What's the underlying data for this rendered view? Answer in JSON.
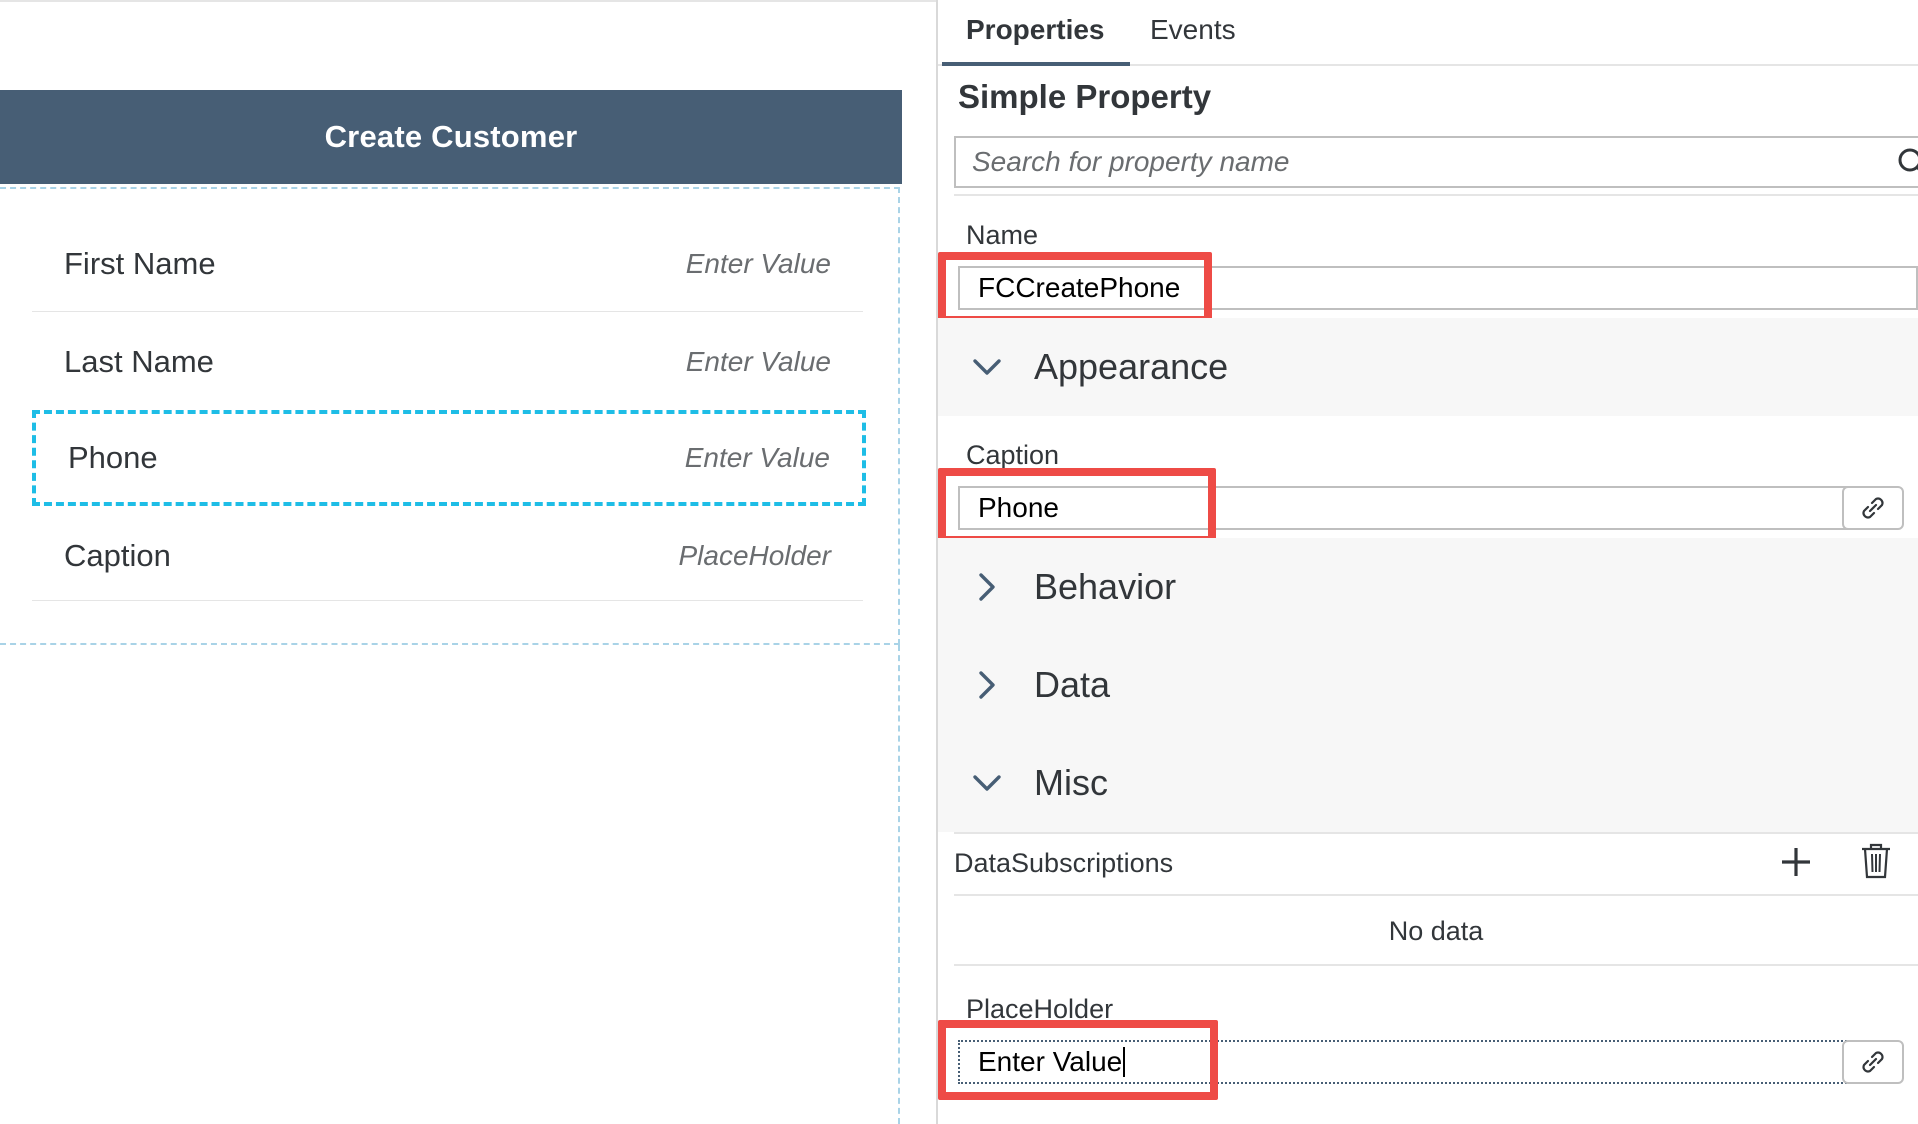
{
  "canvas": {
    "page_title": "Create Customer",
    "rows": [
      {
        "label": "First Name",
        "value": "Enter Value"
      },
      {
        "label": "Last Name",
        "value": "Enter Value"
      },
      {
        "label": "Phone",
        "value": "Enter Value"
      },
      {
        "label": "Caption",
        "value": "PlaceHolder"
      }
    ]
  },
  "panel": {
    "tabs": [
      {
        "label": "Properties",
        "active": true
      },
      {
        "label": "Events",
        "active": false
      }
    ],
    "section_title": "Simple Property",
    "search": {
      "placeholder": "Search for property name"
    },
    "name": {
      "label": "Name",
      "value": "FCCreatePhone"
    },
    "groups": {
      "appearance": "Appearance",
      "behavior": "Behavior",
      "data": "Data",
      "misc": "Misc"
    },
    "caption": {
      "label": "Caption",
      "value": "Phone"
    },
    "data_subscriptions": {
      "label": "DataSubscriptions",
      "empty_text": "No data"
    },
    "placeholder": {
      "label": "PlaceHolder",
      "value": "Enter Value"
    }
  },
  "colors": {
    "header_bg": "#475e75",
    "selection_dash": "#1ebde6",
    "highlight_box": "#ee4b46"
  },
  "icons": [
    "search-icon",
    "chevron-down-icon",
    "chevron-right-icon",
    "link-icon",
    "plus-icon",
    "trash-icon"
  ]
}
